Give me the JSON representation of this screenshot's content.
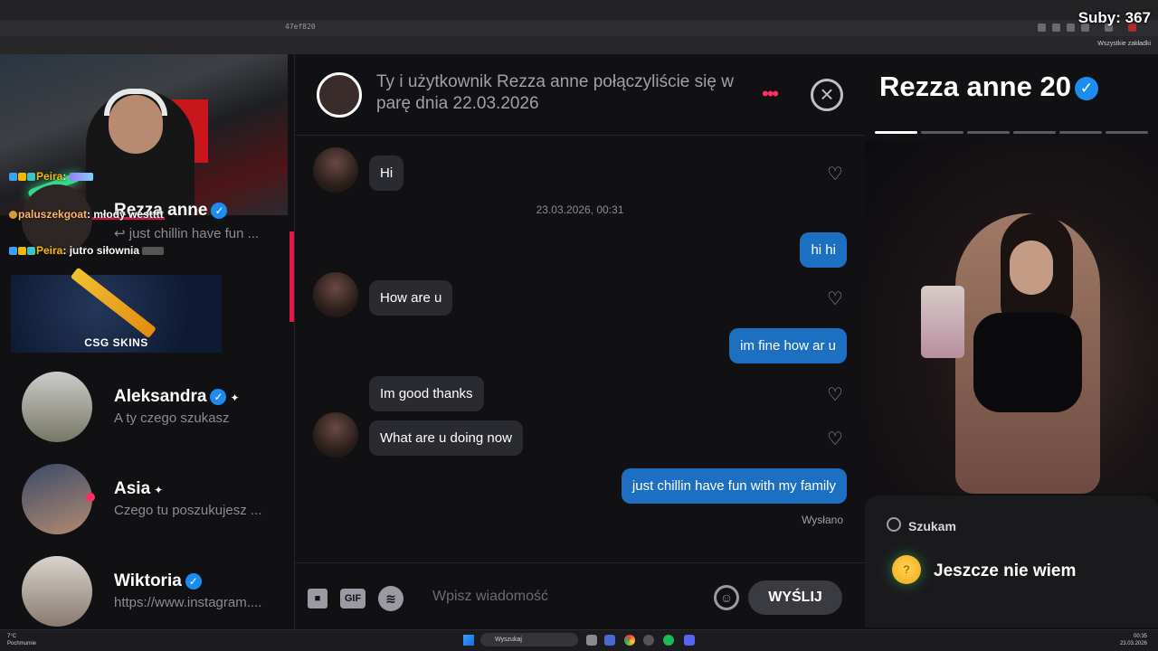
{
  "overlay": {
    "subs": "Suby: 367"
  },
  "browser": {
    "url_fragment": "47ef820",
    "bookmarks_label": "Wszystkie zakładki"
  },
  "stream_chat": [
    {
      "user": "Peira",
      "message": ""
    },
    {
      "user": "paluszekgoat",
      "message": "młody westttt"
    },
    {
      "user": "Peira",
      "message": "jutro siłownia"
    }
  ],
  "ad": {
    "label": "CSG  SKINS"
  },
  "conversations": [
    {
      "name": "Rezza anne",
      "verified": true,
      "preview": "↩ just chillin have fun ..."
    },
    {
      "name": "Aleksandra",
      "verified": true,
      "preview": "A ty czego szukasz"
    },
    {
      "name": "Asia",
      "verified": false,
      "preview": "Czego tu poszukujesz ..."
    },
    {
      "name": "Wiktoria",
      "verified": true,
      "preview": "https://www.instagram...."
    }
  ],
  "chat": {
    "header_text": "Ty i użytkownik Rezza anne połączyliście się w parę dnia 22.03.2026",
    "more_icon": "•••",
    "close_icon": "×",
    "timestamp": "23.03.2026, 00:31",
    "messages": [
      {
        "side": "in",
        "text": "Hi"
      },
      {
        "side": "out",
        "text": "hi hi"
      },
      {
        "side": "in",
        "text": "How are u"
      },
      {
        "side": "out",
        "text": "im fine how ar u"
      },
      {
        "side": "in",
        "text": "Im good thanks"
      },
      {
        "side": "in",
        "text": "What are u doing now"
      },
      {
        "side": "out",
        "text": "just chillin have fun with my family"
      }
    ],
    "sent_label": "Wysłano",
    "composer": {
      "gif_label": "GIF",
      "placeholder": "Wpisz wiadomość",
      "send_label": "WYŚLIJ"
    }
  },
  "profile": {
    "name": "Rezza anne 20",
    "verified": true,
    "photo_count": 6,
    "active_photo": 1,
    "looking_label": "Szukam",
    "looking_value": "Jeszcze nie wiem"
  },
  "taskbar": {
    "weather_temp": "7°C",
    "weather_desc": "Pochmurnie",
    "search_label": "Wyszukaj",
    "time": "00:35",
    "date": "23.03.2026"
  },
  "colors": {
    "accent_pink": "#ff2e63",
    "bubble_out": "#1d6fc2",
    "bubble_in": "#2a2b30",
    "verified_blue": "#1d8cf0"
  }
}
